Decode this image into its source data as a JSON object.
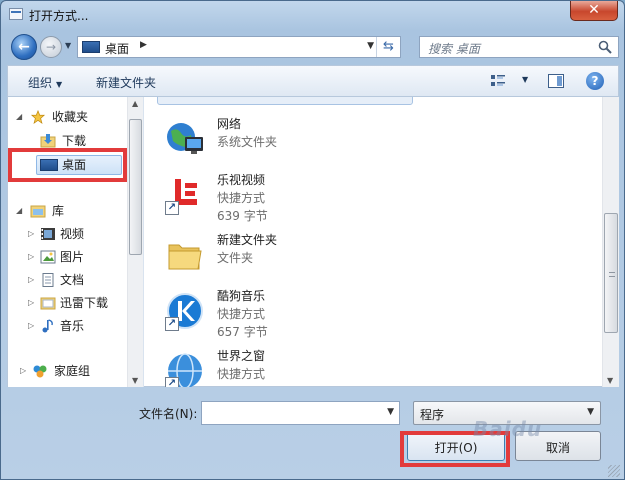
{
  "window": {
    "title": "打开方式...",
    "close_label": "✕"
  },
  "navbar": {
    "back_label": "←",
    "forward_label": "→",
    "address": "桌面",
    "search_placeholder": "搜索 桌面"
  },
  "toolbar": {
    "organize": "组织",
    "new_folder": "新建文件夹",
    "help": "?"
  },
  "navpane": {
    "favorites": "收藏夹",
    "downloads": "下载",
    "desktop": "桌面",
    "libraries": "库",
    "videos": "视频",
    "pictures": "图片",
    "documents": "文档",
    "thunder": "迅雷下载",
    "music": "音乐",
    "homegroup": "家庭组"
  },
  "files": [
    {
      "name": "网络",
      "type": "系统文件夹",
      "size": "",
      "icon": "network-icon"
    },
    {
      "name": "乐视视频",
      "type": "快捷方式",
      "size": "639 字节",
      "icon": "letv-icon"
    },
    {
      "name": "新建文件夹",
      "type": "文件夹",
      "size": "",
      "icon": "folder-icon"
    },
    {
      "name": "酷狗音乐",
      "type": "快捷方式",
      "size": "657 字节",
      "icon": "kugou-icon"
    },
    {
      "name": "世界之窗",
      "type": "快捷方式",
      "size": "",
      "icon": "theworld-icon"
    }
  ],
  "bottom": {
    "filename_label": "文件名(N):",
    "filename_value": "",
    "filetype": "程序",
    "open": "打开(O)",
    "cancel": "取消",
    "watermark": "Baidu"
  },
  "colors": {
    "highlight": "#e23b3b",
    "accent": "#3c7fb1"
  }
}
